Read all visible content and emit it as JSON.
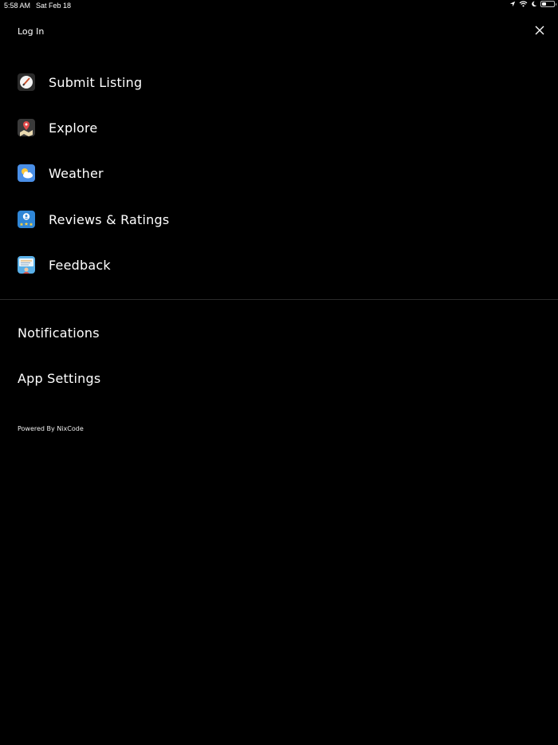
{
  "status_bar": {
    "time": "5:58 AM",
    "date": "Sat Feb 18",
    "icons": [
      "location-icon",
      "wifi-icon",
      "moon-icon",
      "battery-icon"
    ],
    "battery_level": 0.35
  },
  "header": {
    "login_label": "Log In",
    "close_icon": "close-icon"
  },
  "menu": {
    "items": [
      {
        "label": "Submit Listing",
        "icon": "submit-listing-icon"
      },
      {
        "label": "Explore",
        "icon": "explore-map-icon"
      },
      {
        "label": "Weather",
        "icon": "weather-icon"
      },
      {
        "label": "Reviews & Ratings",
        "icon": "reviews-ratings-icon"
      },
      {
        "label": "Feedback",
        "icon": "feedback-icon"
      }
    ]
  },
  "secondary": {
    "notifications_label": "Notifications",
    "app_settings_label": "App Settings"
  },
  "footer": {
    "powered_by": "Powered By NixCode"
  },
  "colors": {
    "background": "#000000",
    "text": "#ffffff",
    "divider": "#2a2a2a",
    "weather_blue": "#4a8fe7",
    "reviews_blue": "#2f86d6"
  }
}
